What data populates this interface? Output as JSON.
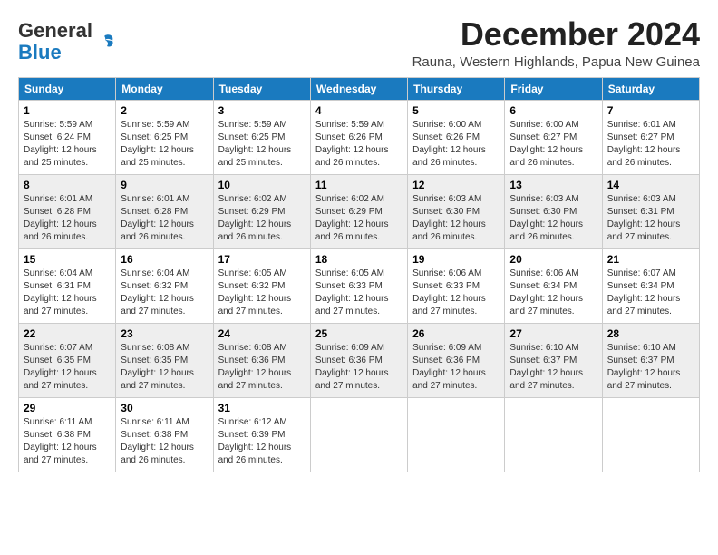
{
  "header": {
    "logo_general": "General",
    "logo_blue": "Blue",
    "month_title": "December 2024",
    "location": "Rauna, Western Highlands, Papua New Guinea"
  },
  "weekdays": [
    "Sunday",
    "Monday",
    "Tuesday",
    "Wednesday",
    "Thursday",
    "Friday",
    "Saturday"
  ],
  "weeks": [
    [
      {
        "day": "1",
        "sunrise": "5:59 AM",
        "sunset": "6:24 PM",
        "daylight": "12 hours and 25 minutes."
      },
      {
        "day": "2",
        "sunrise": "5:59 AM",
        "sunset": "6:25 PM",
        "daylight": "12 hours and 25 minutes."
      },
      {
        "day": "3",
        "sunrise": "5:59 AM",
        "sunset": "6:25 PM",
        "daylight": "12 hours and 25 minutes."
      },
      {
        "day": "4",
        "sunrise": "5:59 AM",
        "sunset": "6:26 PM",
        "daylight": "12 hours and 26 minutes."
      },
      {
        "day": "5",
        "sunrise": "6:00 AM",
        "sunset": "6:26 PM",
        "daylight": "12 hours and 26 minutes."
      },
      {
        "day": "6",
        "sunrise": "6:00 AM",
        "sunset": "6:27 PM",
        "daylight": "12 hours and 26 minutes."
      },
      {
        "day": "7",
        "sunrise": "6:01 AM",
        "sunset": "6:27 PM",
        "daylight": "12 hours and 26 minutes."
      }
    ],
    [
      {
        "day": "8",
        "sunrise": "6:01 AM",
        "sunset": "6:28 PM",
        "daylight": "12 hours and 26 minutes."
      },
      {
        "day": "9",
        "sunrise": "6:01 AM",
        "sunset": "6:28 PM",
        "daylight": "12 hours and 26 minutes."
      },
      {
        "day": "10",
        "sunrise": "6:02 AM",
        "sunset": "6:29 PM",
        "daylight": "12 hours and 26 minutes."
      },
      {
        "day": "11",
        "sunrise": "6:02 AM",
        "sunset": "6:29 PM",
        "daylight": "12 hours and 26 minutes."
      },
      {
        "day": "12",
        "sunrise": "6:03 AM",
        "sunset": "6:30 PM",
        "daylight": "12 hours and 26 minutes."
      },
      {
        "day": "13",
        "sunrise": "6:03 AM",
        "sunset": "6:30 PM",
        "daylight": "12 hours and 26 minutes."
      },
      {
        "day": "14",
        "sunrise": "6:03 AM",
        "sunset": "6:31 PM",
        "daylight": "12 hours and 27 minutes."
      }
    ],
    [
      {
        "day": "15",
        "sunrise": "6:04 AM",
        "sunset": "6:31 PM",
        "daylight": "12 hours and 27 minutes."
      },
      {
        "day": "16",
        "sunrise": "6:04 AM",
        "sunset": "6:32 PM",
        "daylight": "12 hours and 27 minutes."
      },
      {
        "day": "17",
        "sunrise": "6:05 AM",
        "sunset": "6:32 PM",
        "daylight": "12 hours and 27 minutes."
      },
      {
        "day": "18",
        "sunrise": "6:05 AM",
        "sunset": "6:33 PM",
        "daylight": "12 hours and 27 minutes."
      },
      {
        "day": "19",
        "sunrise": "6:06 AM",
        "sunset": "6:33 PM",
        "daylight": "12 hours and 27 minutes."
      },
      {
        "day": "20",
        "sunrise": "6:06 AM",
        "sunset": "6:34 PM",
        "daylight": "12 hours and 27 minutes."
      },
      {
        "day": "21",
        "sunrise": "6:07 AM",
        "sunset": "6:34 PM",
        "daylight": "12 hours and 27 minutes."
      }
    ],
    [
      {
        "day": "22",
        "sunrise": "6:07 AM",
        "sunset": "6:35 PM",
        "daylight": "12 hours and 27 minutes."
      },
      {
        "day": "23",
        "sunrise": "6:08 AM",
        "sunset": "6:35 PM",
        "daylight": "12 hours and 27 minutes."
      },
      {
        "day": "24",
        "sunrise": "6:08 AM",
        "sunset": "6:36 PM",
        "daylight": "12 hours and 27 minutes."
      },
      {
        "day": "25",
        "sunrise": "6:09 AM",
        "sunset": "6:36 PM",
        "daylight": "12 hours and 27 minutes."
      },
      {
        "day": "26",
        "sunrise": "6:09 AM",
        "sunset": "6:36 PM",
        "daylight": "12 hours and 27 minutes."
      },
      {
        "day": "27",
        "sunrise": "6:10 AM",
        "sunset": "6:37 PM",
        "daylight": "12 hours and 27 minutes."
      },
      {
        "day": "28",
        "sunrise": "6:10 AM",
        "sunset": "6:37 PM",
        "daylight": "12 hours and 27 minutes."
      }
    ],
    [
      {
        "day": "29",
        "sunrise": "6:11 AM",
        "sunset": "6:38 PM",
        "daylight": "12 hours and 27 minutes."
      },
      {
        "day": "30",
        "sunrise": "6:11 AM",
        "sunset": "6:38 PM",
        "daylight": "12 hours and 26 minutes."
      },
      {
        "day": "31",
        "sunrise": "6:12 AM",
        "sunset": "6:39 PM",
        "daylight": "12 hours and 26 minutes."
      },
      null,
      null,
      null,
      null
    ]
  ]
}
